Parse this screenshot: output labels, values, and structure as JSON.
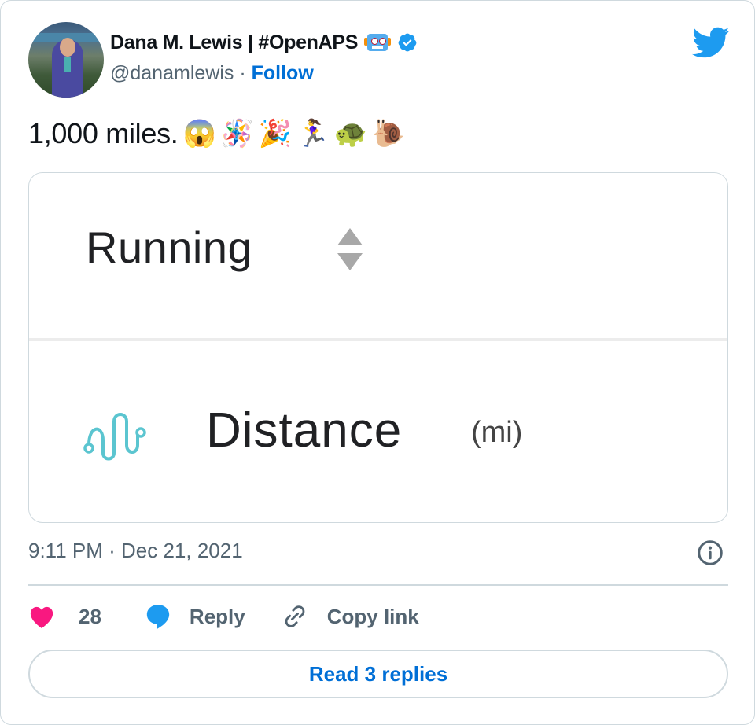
{
  "author": {
    "name": "Dana M. Lewis | #OpenAPS",
    "name_emoji": "robot-face",
    "verified": true,
    "handle": "@danamlewis",
    "separator": "·",
    "follow_label": "Follow"
  },
  "brand_icon": "twitter-bird-icon",
  "tweet": {
    "text": "1,000 miles.",
    "emojis": [
      "😱",
      "🪅",
      "🎉",
      "🏃‍♀️",
      "🐢",
      "🐌"
    ]
  },
  "media": {
    "activity": "Running",
    "metric_label": "Distance",
    "metric_unit": "(mi)"
  },
  "timestamp": "9:11 PM · Dec 21, 2021",
  "actions": {
    "like_count": "28",
    "reply_label": "Reply",
    "copy_link_label": "Copy link"
  },
  "read_replies_label": "Read 3 replies",
  "colors": {
    "brand_blue": "#1d9bf0",
    "link_blue": "#006fd6",
    "like_pink": "#f91880",
    "text_secondary": "#536471",
    "border": "#cfd9de",
    "distance_icon_teal": "#5bc5d0"
  }
}
